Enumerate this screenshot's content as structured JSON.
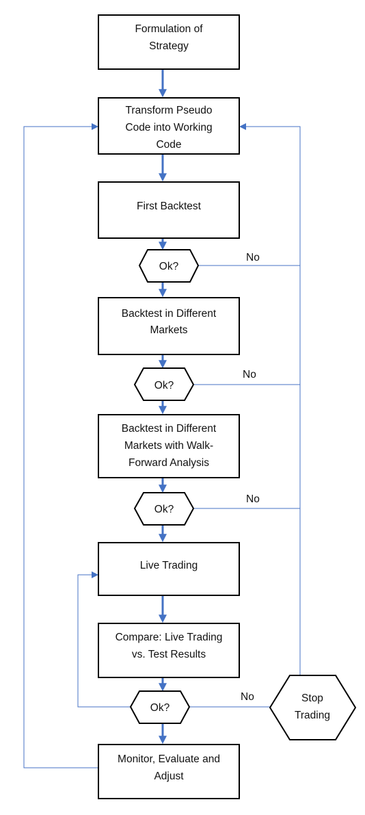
{
  "colors": {
    "arrow": "#4472C4",
    "border": "#000000",
    "fill": "#ffffff"
  },
  "nodes": {
    "formulation": [
      "Formulation of",
      "Strategy"
    ],
    "transform": [
      "Transform Pseudo",
      "Code into Working",
      "Code"
    ],
    "first_backtest": [
      "First Backtest"
    ],
    "decision1": [
      "Ok?"
    ],
    "backtest_markets": [
      "Backtest in Different",
      "Markets"
    ],
    "decision2": [
      "Ok?"
    ],
    "walk_forward": [
      "Backtest in Different",
      "Markets with Walk-",
      "Forward Analysis"
    ],
    "decision3": [
      "Ok?"
    ],
    "live_trading": [
      "Live Trading"
    ],
    "compare": [
      "Compare: Live Trading",
      "vs. Test Results"
    ],
    "decision4": [
      "Ok?"
    ],
    "monitor": [
      "Monitor, Evaluate and",
      "Adjust"
    ],
    "stop": [
      "Stop",
      "Trading"
    ]
  },
  "edge_labels": {
    "no1": "No",
    "no2": "No",
    "no3": "No",
    "no4": "No"
  }
}
